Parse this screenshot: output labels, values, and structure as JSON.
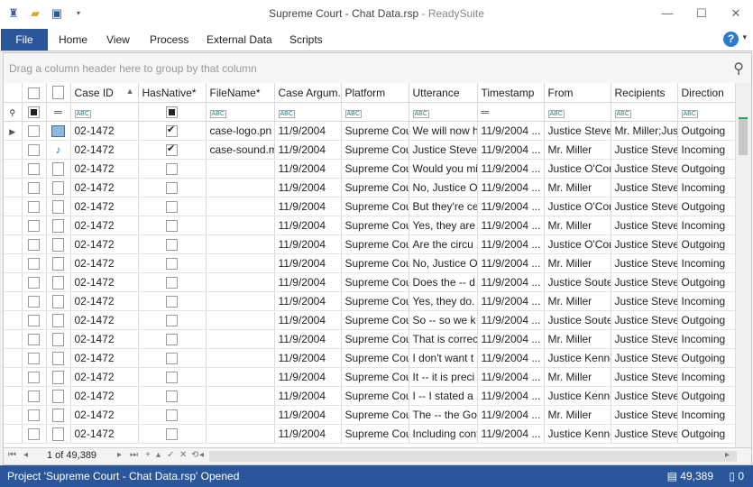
{
  "window": {
    "title": "Supreme Court - Chat Data.rsp",
    "app_suffix": "- ReadySuite"
  },
  "menu": {
    "file": "File",
    "items": [
      "Home",
      "View",
      "Process",
      "External Data",
      "Scripts"
    ],
    "help": "?"
  },
  "grid": {
    "group_hint": "Drag a column header here to group by that column",
    "columns": [
      "Case ID",
      "HasNative*",
      "FileName*",
      "Case Argum...",
      "Platform",
      "Utterance",
      "Timestamp",
      "From",
      "Recipients",
      "Direction"
    ],
    "rows": [
      {
        "icon": "image-file-icon",
        "case": "02-1472",
        "native": true,
        "file": "case-logo.pn",
        "date": "11/9/2004",
        "platform": "Supreme Cou",
        "utt": "We will now h",
        "ts": "11/9/2004 ...",
        "from": "Justice Steve",
        "to": "Mr. Miller;Just",
        "dir": "Outgoing"
      },
      {
        "icon": "audio-file-icon",
        "case": "02-1472",
        "native": true,
        "file": "case-sound.m",
        "date": "11/9/2004",
        "platform": "Supreme Cou",
        "utt": "Justice Steve",
        "ts": "11/9/2004 ...",
        "from": "Mr. Miller",
        "to": "Justice Steve",
        "dir": "Incoming"
      },
      {
        "icon": "document-icon",
        "case": "02-1472",
        "native": false,
        "file": "",
        "date": "11/9/2004",
        "platform": "Supreme Cou",
        "utt": "Would you mi",
        "ts": "11/9/2004 ...",
        "from": "Justice O'Con",
        "to": "Justice Steve",
        "dir": "Outgoing"
      },
      {
        "icon": "document-icon",
        "case": "02-1472",
        "native": false,
        "file": "",
        "date": "11/9/2004",
        "platform": "Supreme Cou",
        "utt": "No, Justice O'",
        "ts": "11/9/2004 ...",
        "from": "Mr. Miller",
        "to": "Justice Steve",
        "dir": "Incoming"
      },
      {
        "icon": "document-icon",
        "case": "02-1472",
        "native": false,
        "file": "",
        "date": "11/9/2004",
        "platform": "Supreme Cou",
        "utt": "But they're ce",
        "ts": "11/9/2004 ...",
        "from": "Justice O'Con",
        "to": "Justice Steve",
        "dir": "Outgoing"
      },
      {
        "icon": "document-icon",
        "case": "02-1472",
        "native": false,
        "file": "",
        "date": "11/9/2004",
        "platform": "Supreme Cou",
        "utt": "Yes, they are",
        "ts": "11/9/2004 ...",
        "from": "Mr. Miller",
        "to": "Justice Steve",
        "dir": "Incoming"
      },
      {
        "icon": "document-icon",
        "case": "02-1472",
        "native": false,
        "file": "",
        "date": "11/9/2004",
        "platform": "Supreme Cou",
        "utt": "Are the circu",
        "ts": "11/9/2004 ...",
        "from": "Justice O'Con",
        "to": "Justice Steve",
        "dir": "Outgoing"
      },
      {
        "icon": "document-icon",
        "case": "02-1472",
        "native": false,
        "file": "",
        "date": "11/9/2004",
        "platform": "Supreme Cou",
        "utt": "No, Justice O'",
        "ts": "11/9/2004 ...",
        "from": "Mr. Miller",
        "to": "Justice Steve",
        "dir": "Incoming"
      },
      {
        "icon": "document-icon",
        "case": "02-1472",
        "native": false,
        "file": "",
        "date": "11/9/2004",
        "platform": "Supreme Cou",
        "utt": "Does the -- d",
        "ts": "11/9/2004 ...",
        "from": "Justice Soute",
        "to": "Justice Steve",
        "dir": "Outgoing"
      },
      {
        "icon": "document-icon",
        "case": "02-1472",
        "native": false,
        "file": "",
        "date": "11/9/2004",
        "platform": "Supreme Cou",
        "utt": "Yes, they do.",
        "ts": "11/9/2004 ...",
        "from": "Mr. Miller",
        "to": "Justice Steve",
        "dir": "Incoming"
      },
      {
        "icon": "document-icon",
        "case": "02-1472",
        "native": false,
        "file": "",
        "date": "11/9/2004",
        "platform": "Supreme Cou",
        "utt": "So -- so we k",
        "ts": "11/9/2004 ...",
        "from": "Justice Soute",
        "to": "Justice Steve",
        "dir": "Outgoing"
      },
      {
        "icon": "document-icon",
        "case": "02-1472",
        "native": false,
        "file": "",
        "date": "11/9/2004",
        "platform": "Supreme Cou",
        "utt": "That is correc",
        "ts": "11/9/2004 ...",
        "from": "Mr. Miller",
        "to": "Justice Steve",
        "dir": "Incoming"
      },
      {
        "icon": "document-icon",
        "case": "02-1472",
        "native": false,
        "file": "",
        "date": "11/9/2004",
        "platform": "Supreme Cou",
        "utt": "I don't want t",
        "ts": "11/9/2004 ...",
        "from": "Justice Kenne",
        "to": "Justice Steve",
        "dir": "Outgoing"
      },
      {
        "icon": "document-icon",
        "case": "02-1472",
        "native": false,
        "file": "",
        "date": "11/9/2004",
        "platform": "Supreme Cou",
        "utt": "It -- it is preci",
        "ts": "11/9/2004 ...",
        "from": "Mr. Miller",
        "to": "Justice Steve",
        "dir": "Incoming"
      },
      {
        "icon": "document-icon",
        "case": "02-1472",
        "native": false,
        "file": "",
        "date": "11/9/2004",
        "platform": "Supreme Cou",
        "utt": "I -- I stated a",
        "ts": "11/9/2004 ...",
        "from": "Justice Kenne",
        "to": "Justice Steve",
        "dir": "Outgoing"
      },
      {
        "icon": "document-icon",
        "case": "02-1472",
        "native": false,
        "file": "",
        "date": "11/9/2004",
        "platform": "Supreme Cou",
        "utt": "The -- the Go",
        "ts": "11/9/2004 ...",
        "from": "Mr. Miller",
        "to": "Justice Steve",
        "dir": "Incoming"
      },
      {
        "icon": "document-icon",
        "case": "02-1472",
        "native": false,
        "file": "",
        "date": "11/9/2004",
        "platform": "Supreme Cou",
        "utt": "Including cont",
        "ts": "11/9/2004 ...",
        "from": "Justice Kenne",
        "to": "Justice Steve",
        "dir": "Outgoing"
      }
    ],
    "pager": "1 of 49,389"
  },
  "status": {
    "message": "Project 'Supreme Court - Chat Data.rsp' Opened",
    "record_count": "49,389",
    "other_count": "0"
  },
  "colors": {
    "accent": "#2b579a",
    "checked_green": "#2aa84a"
  }
}
